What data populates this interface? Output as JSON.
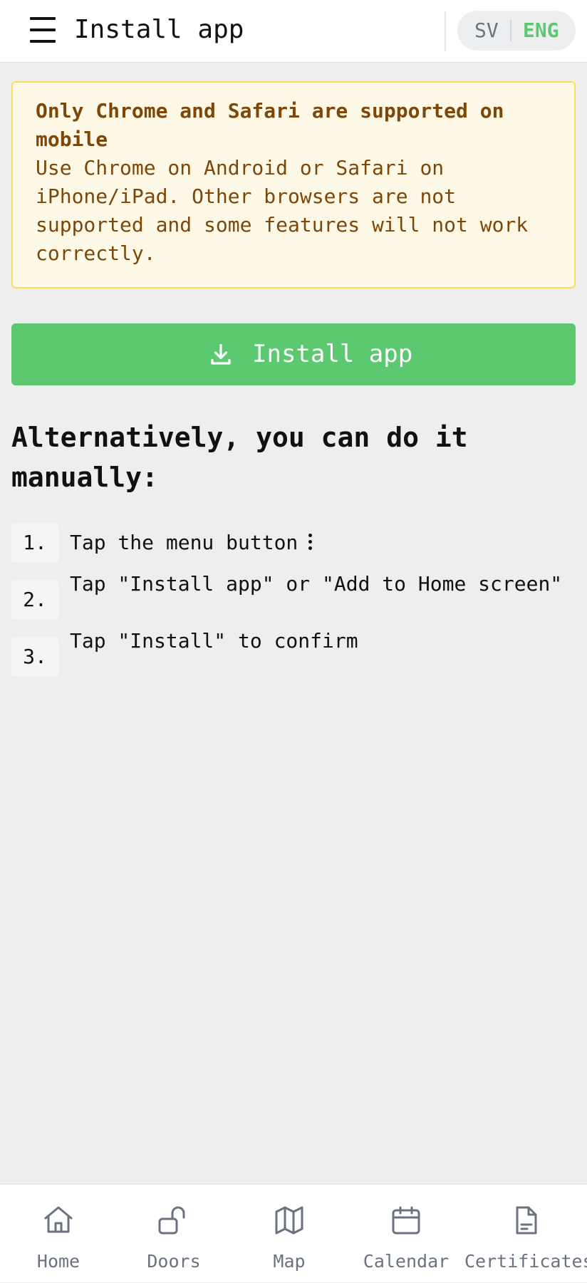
{
  "header": {
    "title": "Install app",
    "lang_sv": "SV",
    "lang_eng": "ENG",
    "active_lang": "ENG"
  },
  "warning": {
    "title": "Only Chrome and Safari are supported on mobile",
    "body": "Use Chrome on Android or Safari on iPhone/iPad. Other browsers are not supported and some features will not work correctly."
  },
  "install_button": {
    "label": "Install app",
    "icon": "download-icon"
  },
  "manual": {
    "heading": "Alternatively, you can do it manually:",
    "steps": [
      {
        "num": "1.",
        "text": "Tap the menu button"
      },
      {
        "num": "2.",
        "text": "Tap \"Install app\" or \"Add to Home screen\""
      },
      {
        "num": "3.",
        "text": "Tap \"Install\" to confirm"
      }
    ]
  },
  "nav": {
    "items": [
      {
        "label": "Home",
        "icon": "home-icon"
      },
      {
        "label": "Doors",
        "icon": "unlocked-padlock-icon"
      },
      {
        "label": "Map",
        "icon": "map-icon"
      },
      {
        "label": "Calendar",
        "icon": "calendar-icon"
      },
      {
        "label": "Certificates",
        "icon": "document-icon"
      }
    ]
  },
  "colors": {
    "accent": "#5cc870",
    "warning_bg": "#fdf9e6",
    "warning_border": "#f6df5a",
    "warning_text": "#7d4709",
    "nav_text": "#6b7280"
  }
}
